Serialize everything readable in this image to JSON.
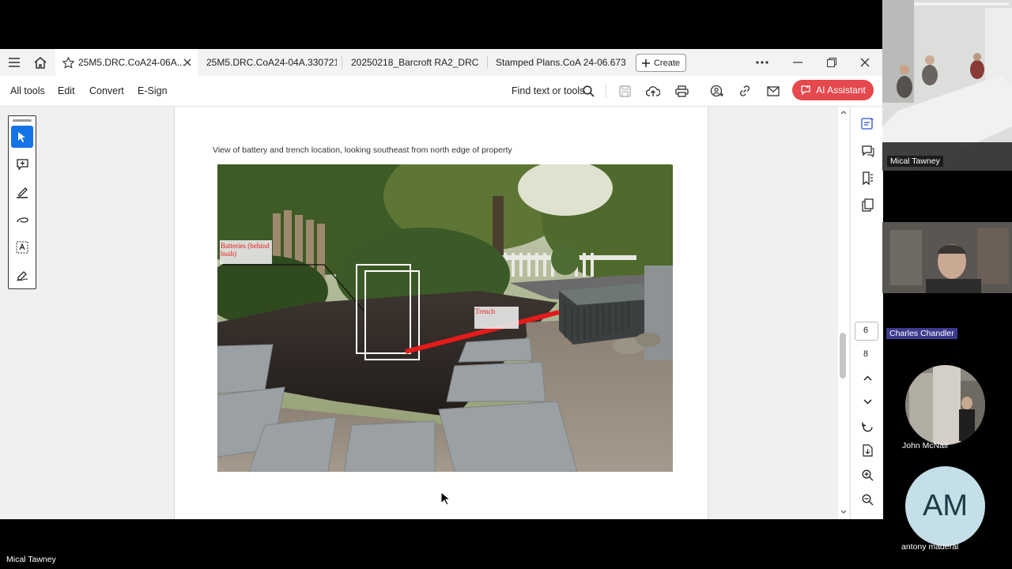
{
  "tabs": [
    {
      "label": "25M5.DRC.CoA24-06A...",
      "active": true
    },
    {
      "label": "25M5.DRC.CoA24-04A.330721s...",
      "active": false
    },
    {
      "label": "20250218_Barcroft RA2_DRC S...",
      "active": false
    },
    {
      "label": "Stamped Plans.CoA 24-06.6733...",
      "active": false
    }
  ],
  "create_label": "Create",
  "menu": [
    "All tools",
    "Edit",
    "Convert",
    "E-Sign"
  ],
  "find_label": "Find text or tools",
  "ai_label": "AI Assistant",
  "document": {
    "caption": "View of battery and trench location, looking southeast from north edge of property",
    "annotations": {
      "batteries": "Batteries (behind bush)",
      "trench": "Trench"
    }
  },
  "page_nav": {
    "current": "6",
    "total": "8"
  },
  "participants": [
    {
      "name": "Mical Tawney"
    },
    {
      "name": "Charles Chandler"
    },
    {
      "name": "John McNair"
    },
    {
      "name": "antony maderal",
      "initials": "AM"
    }
  ],
  "bottom_speaker": "Mical Tawney",
  "colors": {
    "accent": "#e5484d",
    "annotation_red": "#e51b1b",
    "selected_tool": "#1473e6",
    "avatar_bg": "#c5dfe8"
  }
}
